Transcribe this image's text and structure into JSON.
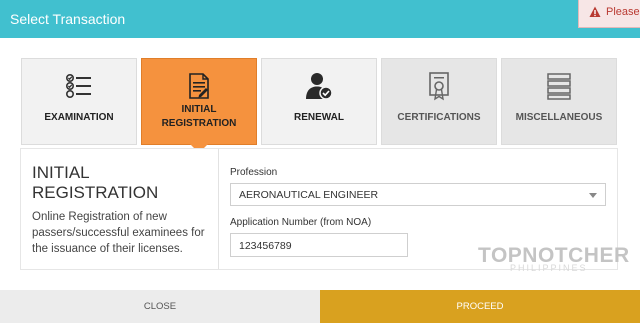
{
  "dialog": {
    "title": "Select Transaction"
  },
  "alert": {
    "text": "Please c"
  },
  "tiles": [
    {
      "label": "EXAMINATION",
      "icon": "checklist-icon",
      "state": "normal"
    },
    {
      "label_line1": "INITIAL",
      "label_line2": "REGISTRATION",
      "icon": "document-edit-icon",
      "state": "selected"
    },
    {
      "label": "RENEWAL",
      "icon": "user-check-icon",
      "state": "normal"
    },
    {
      "label": "CERTIFICATIONS",
      "icon": "certificate-icon",
      "state": "disabled"
    },
    {
      "label": "MISCELLANEOUS",
      "icon": "stack-icon",
      "state": "disabled"
    }
  ],
  "info": {
    "title": "INITIAL REGISTRATION",
    "description": "Online Registration of new passers/successful examinees for the issuance of their licenses."
  },
  "form": {
    "profession_label": "Profession",
    "profession_value": "AERONAUTICAL ENGINEER",
    "app_number_label": "Application Number (from NOA)",
    "app_number_value": "123456789"
  },
  "footer": {
    "close_label": "CLOSE",
    "proceed_label": "PROCEED"
  },
  "watermark": {
    "main": "TOPNOTCHER",
    "sub": "PHILIPPINES"
  },
  "colors": {
    "header": "#41c0cf",
    "selected_tile": "#f5923e",
    "proceed_button": "#d9a11f",
    "alert_text": "#b93a32"
  }
}
